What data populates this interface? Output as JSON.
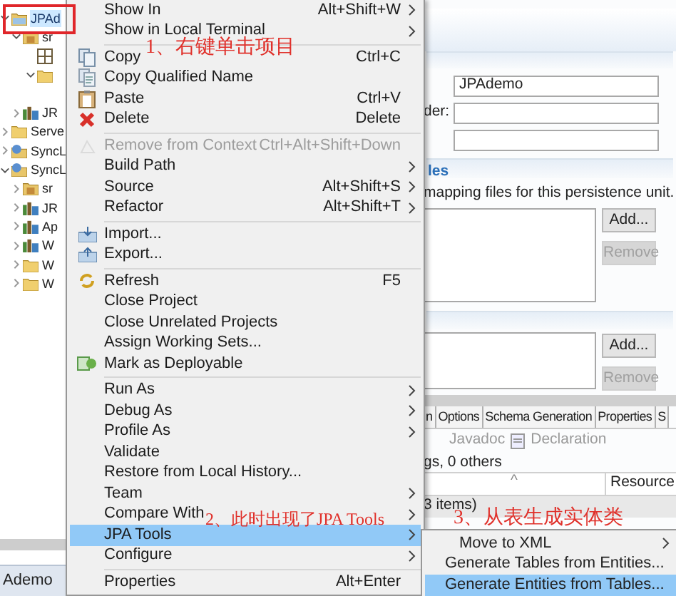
{
  "tree": {
    "items": [
      {
        "label": "JPAd",
        "kind": "project",
        "selected": true,
        "expanded": true,
        "children": [
          {
            "label": "sr",
            "kind": "source",
            "selected": false,
            "expanded": true,
            "children": [
              {
                "kind": "package"
              },
              {
                "kind": "folder",
                "expanded": true
              }
            ]
          },
          {
            "label": "JR",
            "kind": "library",
            "selected": false,
            "expanded": false
          }
        ]
      },
      {
        "label": "Serve",
        "kind": "folder",
        "selected": false,
        "expanded": false
      },
      {
        "label": "SyncL",
        "kind": "web",
        "selected": false,
        "expanded": false
      },
      {
        "label": "SyncL",
        "kind": "web",
        "selected": false,
        "expanded": true,
        "children": [
          {
            "label": "sr",
            "kind": "source",
            "selected": false,
            "expanded": false
          },
          {
            "label": "JR",
            "kind": "library",
            "selected": false,
            "expanded": false
          },
          {
            "label": "Ap",
            "kind": "library",
            "selected": false,
            "expanded": false
          },
          {
            "label": "W",
            "kind": "library",
            "selected": false,
            "expanded": false
          },
          {
            "label": "W",
            "kind": "folder",
            "selected": false,
            "expanded": false
          },
          {
            "label": "W",
            "kind": "folder",
            "selected": false,
            "expanded": false
          }
        ]
      }
    ]
  },
  "bottom_tab": {
    "label": "Ademo"
  },
  "editor": {
    "fields": [
      {
        "value": "JPAdemo"
      },
      {
        "label": "der:"
      }
    ],
    "mapping_section": {
      "heading": "les",
      "description": "mapping files for this persistence unit.",
      "buttons": [
        {
          "label": "Add...",
          "disabled": false
        },
        {
          "label": "Remove",
          "disabled": true
        }
      ]
    },
    "second_section": {
      "buttons": [
        {
          "label": "Add...",
          "disabled": false
        },
        {
          "label": "Remove",
          "disabled": true
        }
      ]
    },
    "tabs": [
      {
        "label": "n",
        "selected": false
      },
      {
        "label": "Options",
        "selected": false
      },
      {
        "label": "Schema Generation",
        "selected": false
      },
      {
        "label": "Properties",
        "selected": false
      },
      {
        "label": "S",
        "selected": false
      }
    ],
    "problems": {
      "toolbar": [
        "Javadoc",
        "Declaration"
      ],
      "summary": "gs, 0 others",
      "sort_mark": "^",
      "columns": [
        "Resource"
      ],
      "group_row": "3 items)"
    }
  },
  "context_menu": {
    "items": [
      {
        "kind": "item",
        "label": "Show In",
        "shortcut": "Alt+Shift+W",
        "submenu": true,
        "disabled": false,
        "selected": false
      },
      {
        "kind": "item",
        "label": "Show in Local Terminal",
        "submenu": true,
        "disabled": false,
        "selected": false
      },
      {
        "kind": "separator"
      },
      {
        "kind": "item",
        "label": "Copy",
        "shortcut": "Ctrl+C",
        "submenu": false,
        "disabled": false,
        "selected": false
      },
      {
        "kind": "item",
        "label": "Copy Qualified Name",
        "submenu": false,
        "disabled": false,
        "selected": false
      },
      {
        "kind": "item",
        "label": "Paste",
        "shortcut": "Ctrl+V",
        "submenu": false,
        "disabled": false,
        "selected": false
      },
      {
        "kind": "item",
        "label": "Delete",
        "shortcut": "Delete",
        "submenu": false,
        "disabled": false,
        "selected": false
      },
      {
        "kind": "separator"
      },
      {
        "kind": "item",
        "label": "Remove from Context",
        "shortcut": "Ctrl+Alt+Shift+Down",
        "submenu": false,
        "disabled": true,
        "selected": false
      },
      {
        "kind": "item",
        "label": "Build Path",
        "submenu": true,
        "disabled": false,
        "selected": false
      },
      {
        "kind": "item",
        "label": "Source",
        "shortcut": "Alt+Shift+S",
        "submenu": true,
        "disabled": false,
        "selected": false
      },
      {
        "kind": "item",
        "label": "Refactor",
        "shortcut": "Alt+Shift+T",
        "submenu": true,
        "disabled": false,
        "selected": false
      },
      {
        "kind": "separator"
      },
      {
        "kind": "item",
        "label": "Import...",
        "submenu": false,
        "disabled": false,
        "selected": false
      },
      {
        "kind": "item",
        "label": "Export...",
        "submenu": false,
        "disabled": false,
        "selected": false
      },
      {
        "kind": "separator"
      },
      {
        "kind": "item",
        "label": "Refresh",
        "shortcut": "F5",
        "submenu": false,
        "disabled": false,
        "selected": false
      },
      {
        "kind": "item",
        "label": "Close Project",
        "submenu": false,
        "disabled": false,
        "selected": false
      },
      {
        "kind": "item",
        "label": "Close Unrelated Projects",
        "submenu": false,
        "disabled": false,
        "selected": false
      },
      {
        "kind": "item",
        "label": "Assign Working Sets...",
        "submenu": false,
        "disabled": false,
        "selected": false
      },
      {
        "kind": "item",
        "label": "Mark as Deployable",
        "submenu": false,
        "disabled": false,
        "selected": false
      },
      {
        "kind": "separator"
      },
      {
        "kind": "item",
        "label": "Run As",
        "submenu": true,
        "disabled": false,
        "selected": false
      },
      {
        "kind": "item",
        "label": "Debug As",
        "submenu": true,
        "disabled": false,
        "selected": false
      },
      {
        "kind": "item",
        "label": "Profile As",
        "submenu": true,
        "disabled": false,
        "selected": false
      },
      {
        "kind": "item",
        "label": "Validate",
        "submenu": false,
        "disabled": false,
        "selected": false
      },
      {
        "kind": "item",
        "label": "Restore from Local History...",
        "submenu": false,
        "disabled": false,
        "selected": false
      },
      {
        "kind": "item",
        "label": "Team",
        "submenu": true,
        "disabled": false,
        "selected": false
      },
      {
        "kind": "item",
        "label": "Compare With",
        "submenu": true,
        "disabled": false,
        "selected": false
      },
      {
        "kind": "item",
        "label": "JPA Tools",
        "submenu": true,
        "disabled": false,
        "selected": true
      },
      {
        "kind": "item",
        "label": "Configure",
        "submenu": true,
        "disabled": false,
        "selected": false
      },
      {
        "kind": "separator"
      },
      {
        "kind": "item",
        "label": "Properties",
        "shortcut": "Alt+Enter",
        "submenu": false,
        "disabled": false,
        "selected": false
      }
    ]
  },
  "submenu": {
    "items": [
      {
        "label": "Move to XML",
        "submenu": true,
        "selected": false
      },
      {
        "label": "Generate Tables from Entities...",
        "submenu": false,
        "selected": false
      },
      {
        "label": "Generate Entities from Tables...",
        "submenu": false,
        "selected": true
      }
    ]
  },
  "annotations": [
    {
      "text": "1、右键单击项目"
    },
    {
      "text": "2、此时出现了JPA Tools"
    },
    {
      "text": "3、从表生成实体类"
    }
  ]
}
